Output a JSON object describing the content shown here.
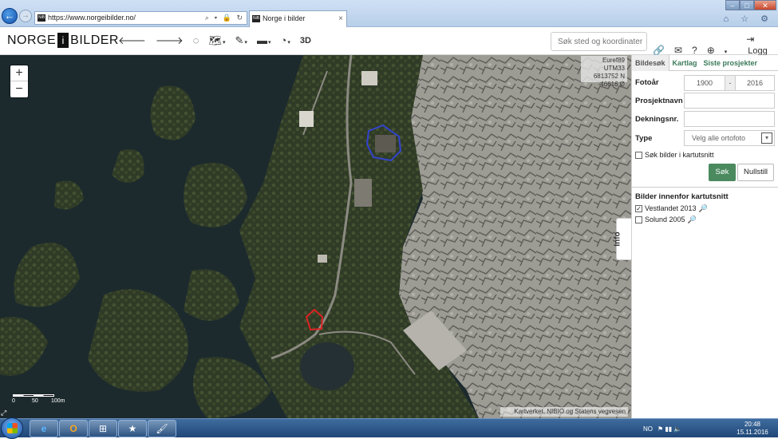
{
  "browser": {
    "url": "https://www.norgeibilder.no/",
    "tab_title": "Norge i bilder",
    "favicon_text": "NiB",
    "tab_close": "×",
    "back": "←",
    "forward": "→",
    "addr_icons": "⌕ ▾ 🔒 ↻",
    "min": "–",
    "max": "□",
    "close": "✕",
    "right_icons": "⌂ ☆ ⚙"
  },
  "app": {
    "logo_left": "NORGE",
    "logo_i": "i",
    "logo_right": "BILDER",
    "toolbar": {
      "back": "🡐",
      "forward": "🡒",
      "circle": "◌",
      "map": "🗺",
      "pen": "✎",
      "print": "▬",
      "clock": "◔",
      "caret": "▾",
      "three_d": "3D"
    },
    "search_placeholder": "Søk sted og koordinater",
    "icons": {
      "link": "🔗",
      "mail": "✉",
      "help": "?",
      "globe": "⊕"
    },
    "login_label": "Logg inn"
  },
  "map": {
    "zoom_in": "+",
    "zoom_out": "−",
    "coords": [
      "Euref89 UTM33",
      "6813752 N",
      "-46616 Ø"
    ],
    "scale_labels": [
      "0",
      "50",
      "100m"
    ],
    "attribution": "Kartverket, NIBIO og Statens vegvesen",
    "corner_icon": "⤢",
    "info_tab": "Info",
    "colors": {
      "water": "#1c2a2e",
      "land": "#3b4a2e",
      "rock": "#9a9a94",
      "polygon_blue": "#3344cc",
      "polygon_red": "#dd2222"
    }
  },
  "sidebar": {
    "tabs": [
      "Bildesøk",
      "Kartlag",
      "Siste prosjekter"
    ],
    "fotoar_label": "Fotoår",
    "year_from": "1900",
    "year_sep": "-",
    "year_to": "2016",
    "prosjektnavn_label": "Prosjektnavn",
    "prosjektnavn_value": "",
    "dekningsnr_label": "Dekningsnr.",
    "dekningsnr_value": "",
    "type_label": "Type",
    "type_value": "Velg alle ortofoto",
    "type_dd": "▾",
    "search_in_view_label": "Søk bilder i kartutsnitt",
    "search_in_view_checked": false,
    "sok_button": "Søk",
    "reset_button": "Nullstill",
    "results_heading": "Bilder innenfor kartutsnitt",
    "results": [
      {
        "label": "Vestlandet 2013",
        "checked": true,
        "mark": "✓"
      },
      {
        "label": "Solund 2005",
        "checked": false,
        "mark": ""
      }
    ],
    "magnifier": "🔎",
    "accent": "#4a8a5e"
  },
  "taskbar": {
    "apps": [
      "e",
      "O",
      "⊞",
      "★",
      "🖌"
    ],
    "lang": "NO",
    "tray_icons": "⚑ ▮▮ 🔈",
    "time": "20:48",
    "date": "15.11.2016"
  }
}
